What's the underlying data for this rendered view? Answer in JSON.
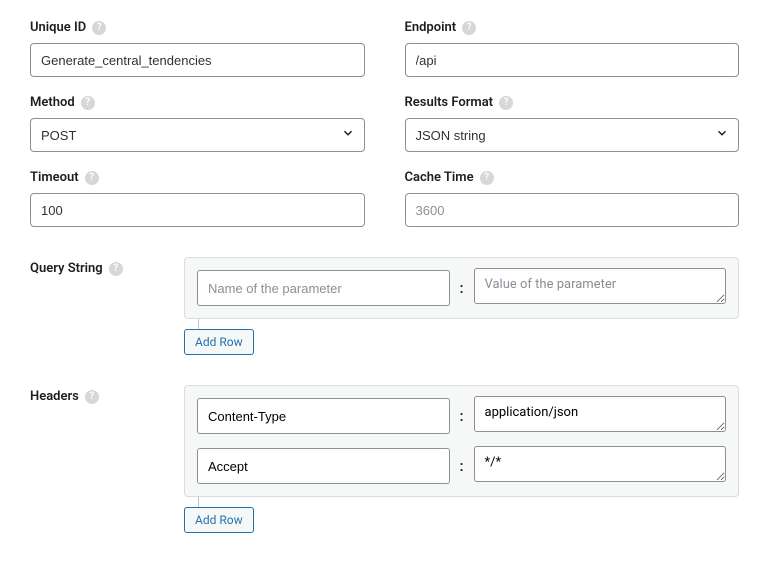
{
  "fields": {
    "unique_id": {
      "label": "Unique ID",
      "value": "Generate_central_tendencies"
    },
    "endpoint": {
      "label": "Endpoint",
      "value": "/api"
    },
    "method": {
      "label": "Method",
      "value": "POST"
    },
    "results_format": {
      "label": "Results Format",
      "value": "JSON string"
    },
    "timeout": {
      "label": "Timeout",
      "value": "100"
    },
    "cache_time": {
      "label": "Cache Time",
      "placeholder": "3600",
      "value": ""
    }
  },
  "query_string": {
    "label": "Query String",
    "name_placeholder": "Name of the parameter",
    "value_placeholder": "Value of the parameter",
    "rows": [
      {
        "name": "",
        "value": ""
      }
    ],
    "add_row_label": "Add Row"
  },
  "headers": {
    "label": "Headers",
    "rows": [
      {
        "name": "Content-Type",
        "value": "application/json"
      },
      {
        "name": "Accept",
        "value": "*/*"
      }
    ],
    "add_row_label": "Add Row"
  },
  "colon": ":",
  "help_glyph": "?"
}
